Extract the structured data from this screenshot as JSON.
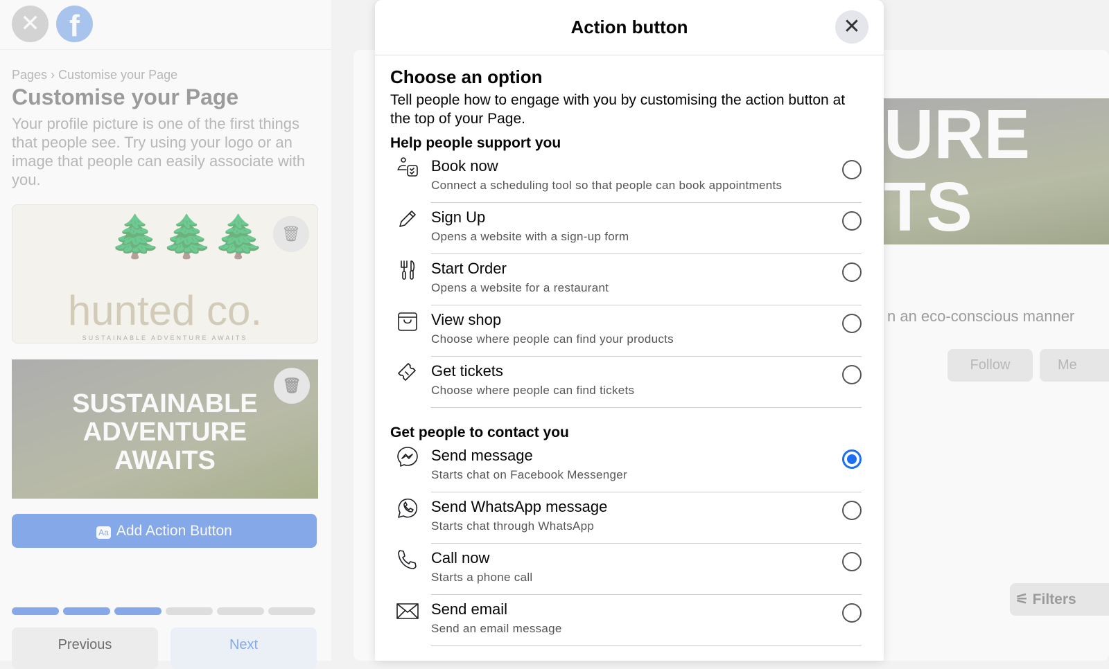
{
  "background": {
    "breadcrumb": "Pages › Customise your Page",
    "title": "Customise your Page",
    "description": "Your profile picture is one of the first things that people see. Try using your logo or an image that people can easily associate with you.",
    "logo_text": "hunted co.",
    "logo_tagline": "SUSTAINABLE ADVENTURE AWAITS",
    "cover_text": "SUSTAINABLE ADVENTURE AWAITS",
    "add_action_label": "Add Action Button",
    "add_action_icon": "Aa",
    "progress": {
      "completed_steps": 3,
      "total_steps": 6
    },
    "previous_label": "Previous",
    "next_label": "Next",
    "cover_right_text": "URE TS",
    "page_tagline": "n an eco-conscious manner",
    "follow_label": "Follow",
    "message_label": "Me",
    "filters_label": "Filters"
  },
  "modal": {
    "title": "Action button",
    "heading": "Choose an option",
    "intro": "Tell people how to engage with you by customising the action button at the top of your Page.",
    "sections": [
      {
        "title": "Help people support you",
        "options": [
          {
            "icon": "calendar-person-icon",
            "title": "Book now",
            "subtitle": "Connect a scheduling tool so that people can book appointments",
            "selected": false
          },
          {
            "icon": "pencil-icon",
            "title": "Sign Up",
            "subtitle": "Opens a website with a sign-up form",
            "selected": false
          },
          {
            "icon": "fork-knife-icon",
            "title": "Start Order",
            "subtitle": "Opens a website for a restaurant",
            "selected": false
          },
          {
            "icon": "shopping-bag-icon",
            "title": "View shop",
            "subtitle": "Choose where people can find your products",
            "selected": false
          },
          {
            "icon": "ticket-icon",
            "title": "Get tickets",
            "subtitle": "Choose where people can find tickets",
            "selected": false
          }
        ]
      },
      {
        "title": "Get people to contact you",
        "options": [
          {
            "icon": "messenger-icon",
            "title": "Send message",
            "subtitle": "Starts chat on Facebook Messenger",
            "selected": true
          },
          {
            "icon": "whatsapp-icon",
            "title": "Send WhatsApp message",
            "subtitle": "Starts chat through WhatsApp",
            "selected": false
          },
          {
            "icon": "phone-icon",
            "title": "Call now",
            "subtitle": "Starts a phone call",
            "selected": false
          },
          {
            "icon": "envelope-icon",
            "title": "Send email",
            "subtitle": "Send an email message",
            "selected": false
          }
        ]
      }
    ],
    "accent_color": "#1b6ff0"
  }
}
